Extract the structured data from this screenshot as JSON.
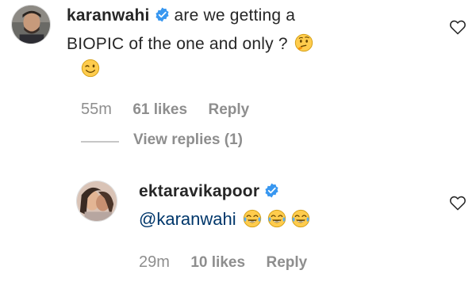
{
  "comments": [
    {
      "username": "karanwahi",
      "text_line1": "are we getting a",
      "text_line2": "BIOPIC of the one and only ?",
      "time": "55m",
      "likes": "61 likes",
      "reply_label": "Reply",
      "view_replies": "View replies (1)"
    },
    {
      "username": "ektaravikapoor",
      "mention": "@karanwahi",
      "time": "29m",
      "likes": "10 likes",
      "reply_label": "Reply"
    }
  ],
  "icons": [
    "verified-badge-icon",
    "thinking-face-icon",
    "winking-face-icon",
    "tears-of-joy-icon",
    "heart-icon"
  ],
  "colors": {
    "verified": "#3897f0",
    "text": "#262626",
    "meta": "#8e8e8e",
    "mention": "#00376b"
  }
}
